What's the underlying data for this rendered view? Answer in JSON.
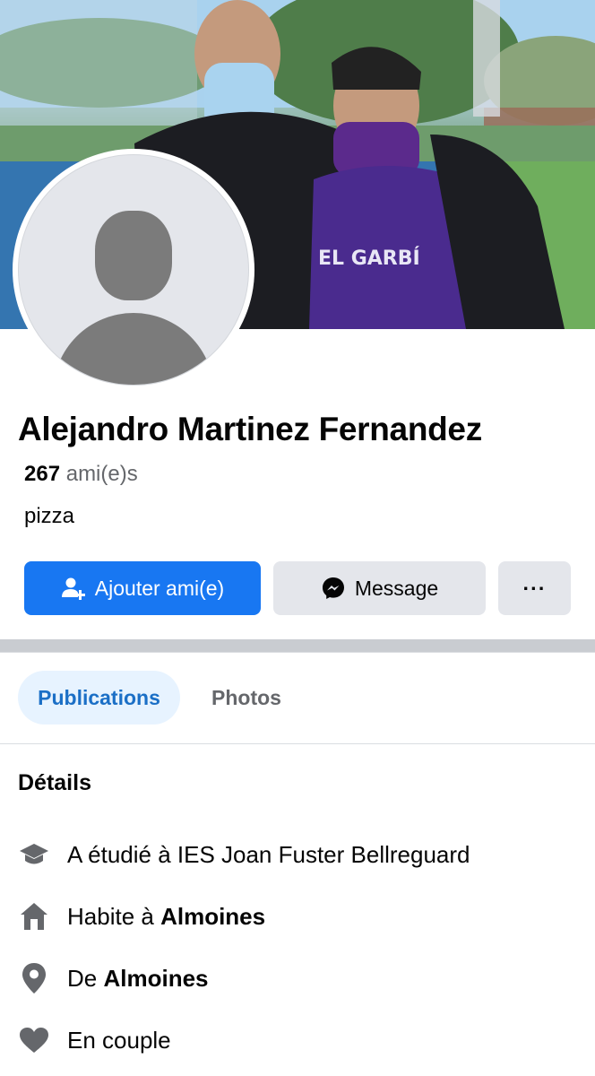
{
  "profile": {
    "name": "Alejandro Martinez Fernandez",
    "friends_count": "267",
    "friends_label": "ami(e)s",
    "bio": "pizza"
  },
  "actions": {
    "add_friend_label": "Ajouter ami(e)",
    "message_label": "Message",
    "more_label": "···"
  },
  "tabs": [
    {
      "label": "Publications",
      "active": true
    },
    {
      "label": "Photos",
      "active": false
    }
  ],
  "details": {
    "title": "Détails",
    "items": [
      {
        "icon": "graduation-cap-icon",
        "prefix": "A étudié à IES Joan Fuster Bellreguard",
        "bold": ""
      },
      {
        "icon": "home-icon",
        "prefix": "Habite à ",
        "bold": "Almoines"
      },
      {
        "icon": "location-pin-icon",
        "prefix": "De ",
        "bold": "Almoines"
      },
      {
        "icon": "heart-icon",
        "prefix": "En couple",
        "bold": ""
      }
    ]
  },
  "colors": {
    "primary": "#1877f2",
    "secondary_button": "#e4e6eb",
    "active_tab_bg": "#e7f3ff",
    "active_tab_text": "#1b6fc6",
    "muted_text": "#65676b",
    "icon_gray": "#65676b"
  }
}
